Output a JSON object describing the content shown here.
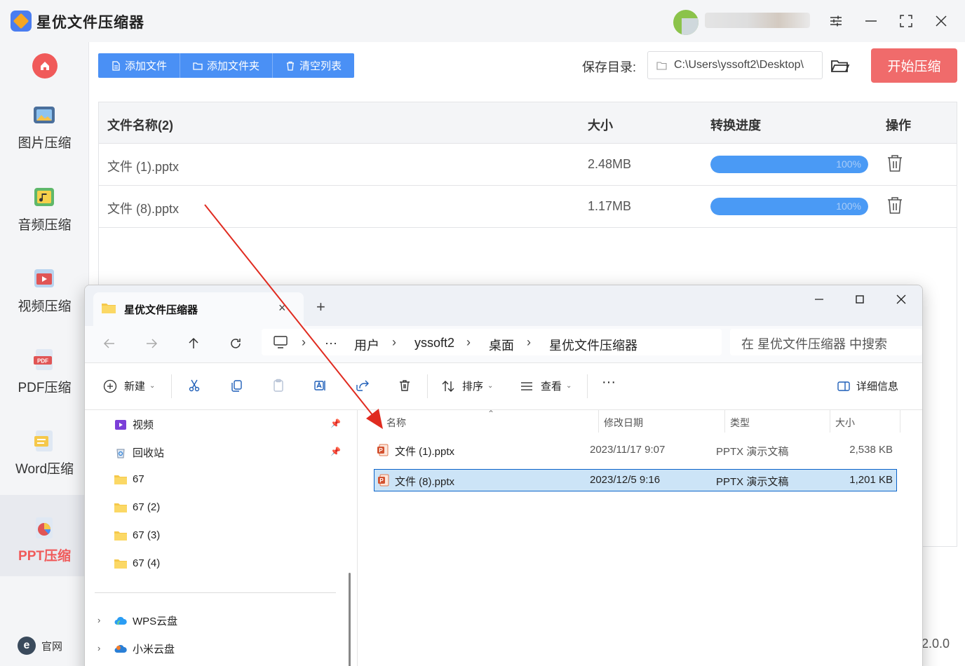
{
  "app": {
    "title": "星优文件压缩器",
    "colors": {
      "accent": "#4a90f5",
      "danger": "#f06b6b",
      "progress": "#4a9af5"
    }
  },
  "sidebar": {
    "home_icon": "home-icon",
    "items": [
      {
        "label": "图片压缩",
        "icon": "image-icon"
      },
      {
        "label": "音频压缩",
        "icon": "music-icon"
      },
      {
        "label": "视频压缩",
        "icon": "video-icon"
      },
      {
        "label": "PDF压缩",
        "icon": "pdf-icon"
      },
      {
        "label": "Word压缩",
        "icon": "word-icon"
      },
      {
        "label": "PPT压缩",
        "icon": "ppt-icon",
        "active": true
      }
    ],
    "footer_label": "官网",
    "footer_icon_glyph": "e"
  },
  "toolbar": {
    "add_file": "添加文件",
    "add_folder": "添加文件夹",
    "clear_list": "清空列表",
    "save_dir_label": "保存目录:",
    "save_dir_value": "C:\\Users\\yssoft2\\Desktop\\",
    "start_button": "开始压缩"
  },
  "table": {
    "headers": {
      "name": "文件名称(2)",
      "size": "大小",
      "progress": "转换进度",
      "action": "操作"
    },
    "rows": [
      {
        "name": "文件 (1).pptx",
        "size": "2.48MB",
        "progress": 100,
        "progress_label": "100%"
      },
      {
        "name": "文件 (8).pptx",
        "size": "1.17MB",
        "progress": 100,
        "progress_label": "100%"
      }
    ]
  },
  "version": "2.0.0",
  "explorer": {
    "tab_title": "星优文件压缩器",
    "new_tab": "+",
    "tab_close": "×",
    "breadcrumb": [
      "用户",
      "yssoft2",
      "桌面",
      "星优文件压缩器"
    ],
    "breadcrumb_more": "···",
    "breadcrumb_sep": "›",
    "search_placeholder": "在 星优文件压缩器 中搜索",
    "commands": {
      "new": "新建",
      "sort": "排序",
      "view": "查看",
      "more": "···",
      "details": "详细信息"
    },
    "nav_items": [
      {
        "label": "视频",
        "icon": "video-library-icon",
        "pinned": true
      },
      {
        "label": "回收站",
        "icon": "recycle-bin-icon",
        "pinned": true
      },
      {
        "label": "67",
        "icon": "folder-icon"
      },
      {
        "label": "67 (2)",
        "icon": "folder-icon"
      },
      {
        "label": "67 (3)",
        "icon": "folder-icon"
      },
      {
        "label": "67 (4)",
        "icon": "folder-icon"
      }
    ],
    "cloud_items": [
      {
        "label": "WPS云盘",
        "icon": "wps-cloud-icon"
      },
      {
        "label": "小米云盘",
        "icon": "mi-cloud-icon"
      }
    ],
    "columns": {
      "name": "名称",
      "date": "修改日期",
      "type": "类型",
      "size": "大小"
    },
    "files": [
      {
        "name": "文件 (1).pptx",
        "date": "2023/11/17 9:07",
        "type": "PPTX 演示文稿",
        "size": "2,538 KB",
        "selected": false
      },
      {
        "name": "文件 (8).pptx",
        "date": "2023/12/5 9:16",
        "type": "PPTX 演示文稿",
        "size": "1,201 KB",
        "selected": true
      }
    ]
  }
}
